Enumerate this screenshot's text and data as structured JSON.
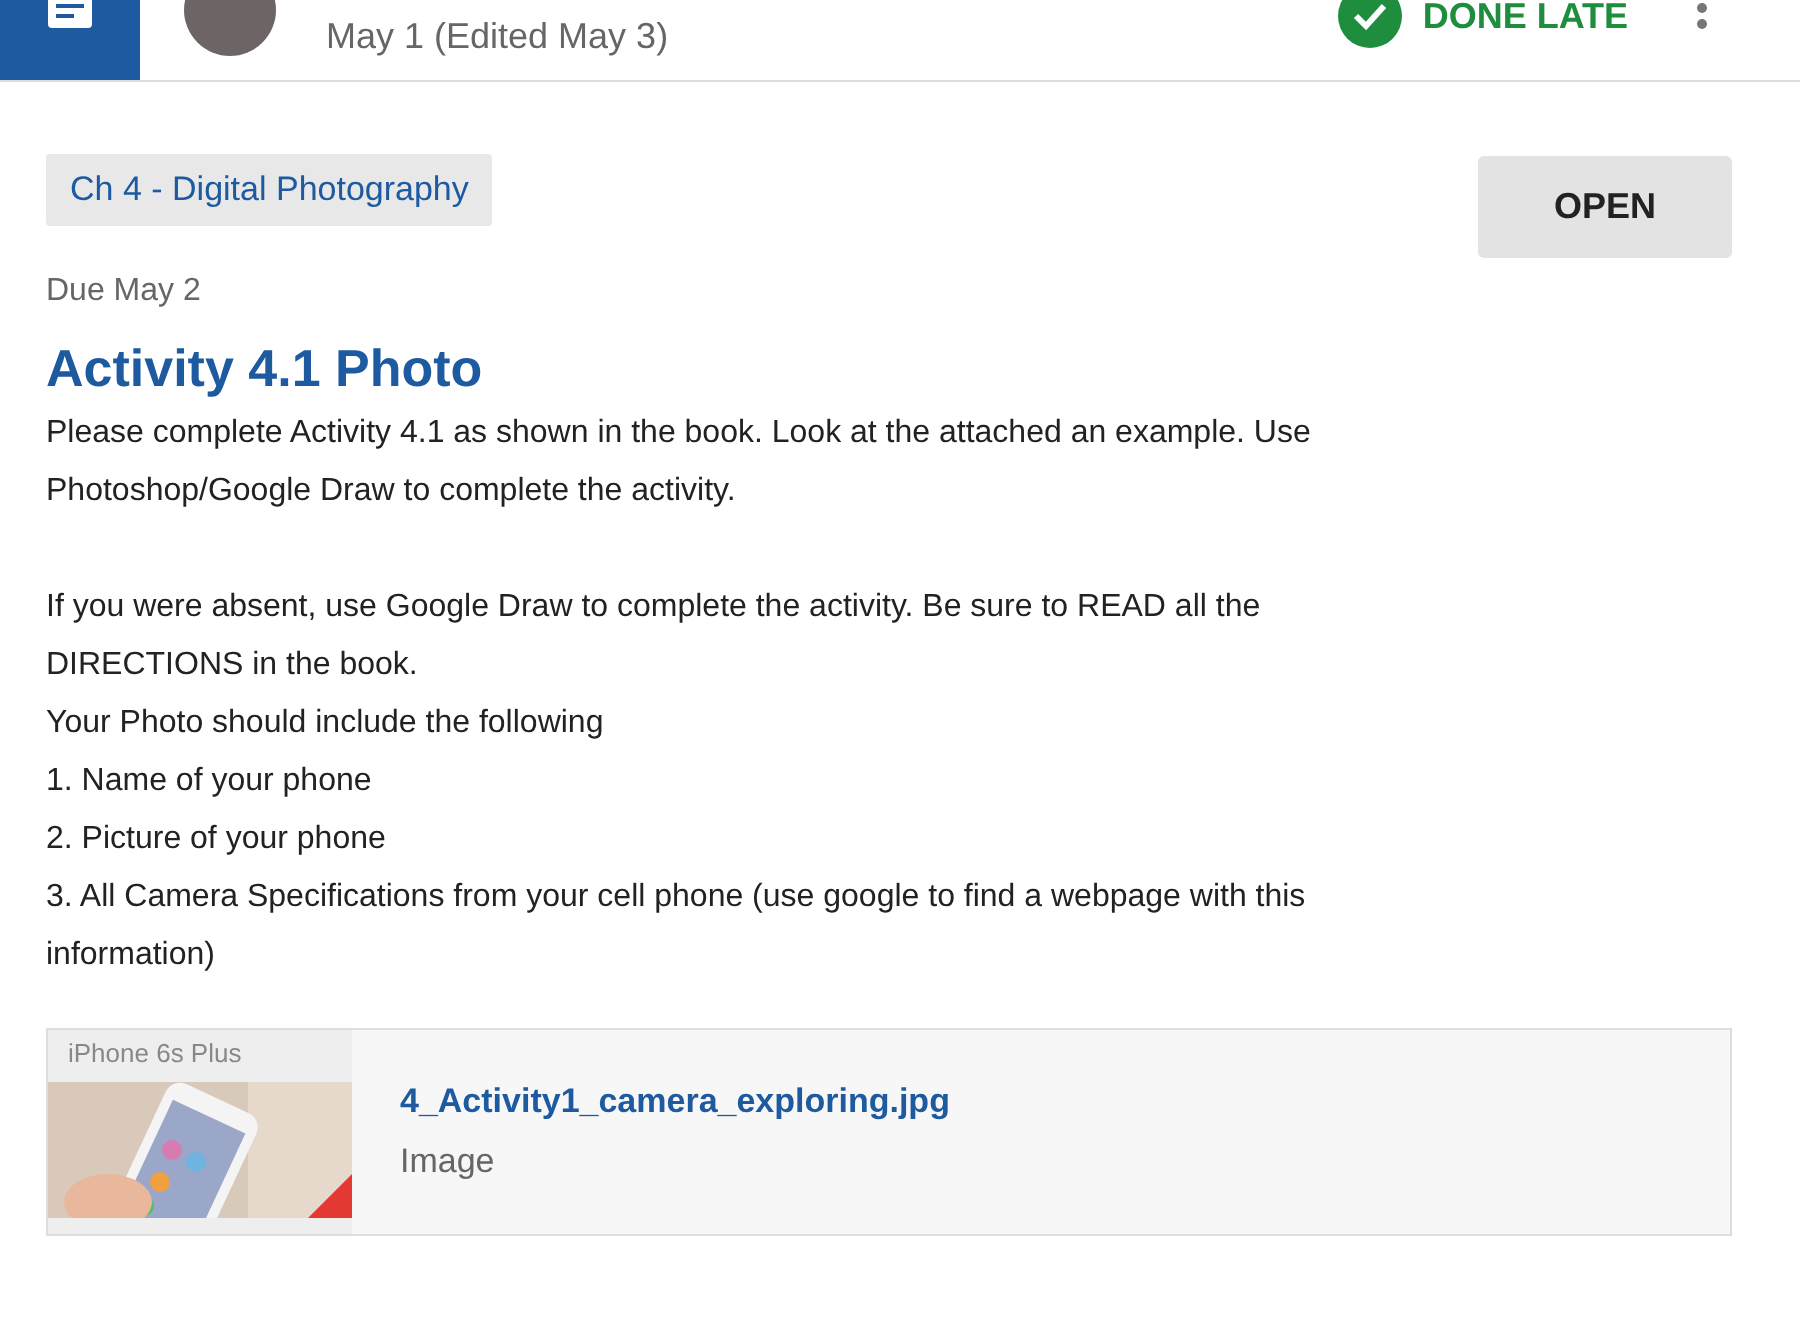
{
  "header": {
    "posted": "May 1 (Edited May 3)",
    "status": "DONE LATE"
  },
  "topic": "Ch 4 - Digital Photography",
  "open_button": "OPEN",
  "due": "Due May 2",
  "title": "Activity 4.1 Photo",
  "paragraphs": [
    "Please complete Activity 4.1 as shown in the book. Look at the attached an example. Use Photoshop/Google Draw to complete the activity.",
    "If you were absent, use Google Draw to complete the activity. Be sure to READ all the DIRECTIONS in the book.",
    "Your Photo should include the following",
    "1. Name of your phone",
    "2. Picture of your phone",
    "3. All Camera Specifications from your cell phone (use google to find a webpage with this information)"
  ],
  "attachment": {
    "thumbnail_caption": "iPhone 6s Plus",
    "file_name": "4_Activity1_camera_exploring.jpg",
    "file_type": "Image"
  }
}
